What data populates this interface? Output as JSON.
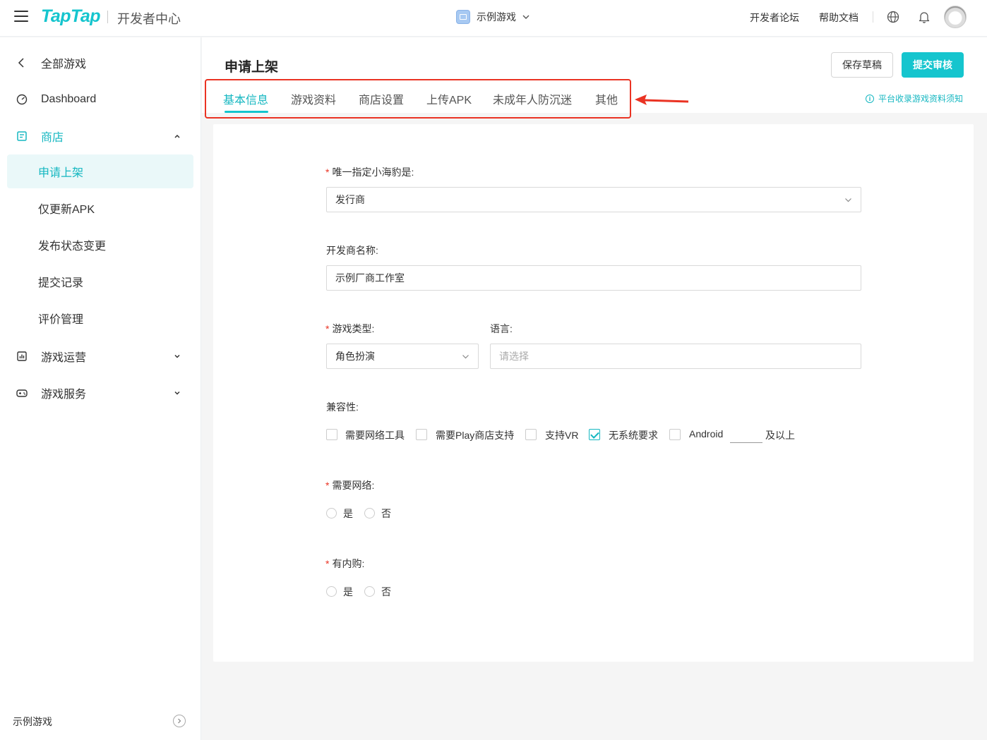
{
  "header": {
    "logo": "TapTap",
    "logo_sub": "开发者中心",
    "game_switch": "示例游戏",
    "links": [
      "开发者论坛",
      "帮助文档"
    ]
  },
  "sidebar": {
    "back_label": "全部游戏",
    "dashboard_label": "Dashboard",
    "store_label": "商店",
    "store_children": [
      "申请上架",
      "仅更新APK",
      "发布状态变更",
      "提交记录",
      "评价管理"
    ],
    "ops_label": "游戏运营",
    "service_label": "游戏服务",
    "footer_label": "示例游戏"
  },
  "page": {
    "title": "申请上架",
    "save_draft": "保存草稿",
    "submit": "提交审核",
    "tabs": [
      "基本信息",
      "游戏资料",
      "商店设置",
      "上传APK",
      "未成年人防沉迷",
      "其他"
    ],
    "active_tab": 0,
    "notice": "平台收录游戏资料须知"
  },
  "form": {
    "seal_label": "唯一指定小海豹是:",
    "seal_value": "发行商",
    "dev_name_label": "开发商名称:",
    "dev_name_value": "示例厂商工作室",
    "genre_label": "游戏类型:",
    "genre_value": "角色扮演",
    "lang_label": "语言:",
    "lang_placeholder": "请选择",
    "compat_label": "兼容性:",
    "compat_options": [
      {
        "label": "需要网络工具",
        "checked": false
      },
      {
        "label": "需要Play商店支持",
        "checked": false
      },
      {
        "label": "支持VR",
        "checked": false
      },
      {
        "label": "无系统要求",
        "checked": true
      },
      {
        "label": "Android",
        "checked": false
      }
    ],
    "android_suffix": "及以上",
    "network_label": "需要网络:",
    "iap_label": "有内购:",
    "yes": "是",
    "no": "否"
  },
  "colors": {
    "accent": "#15c5ce",
    "accent_text": "#15b7c1",
    "highlight_red": "#ea3323"
  }
}
